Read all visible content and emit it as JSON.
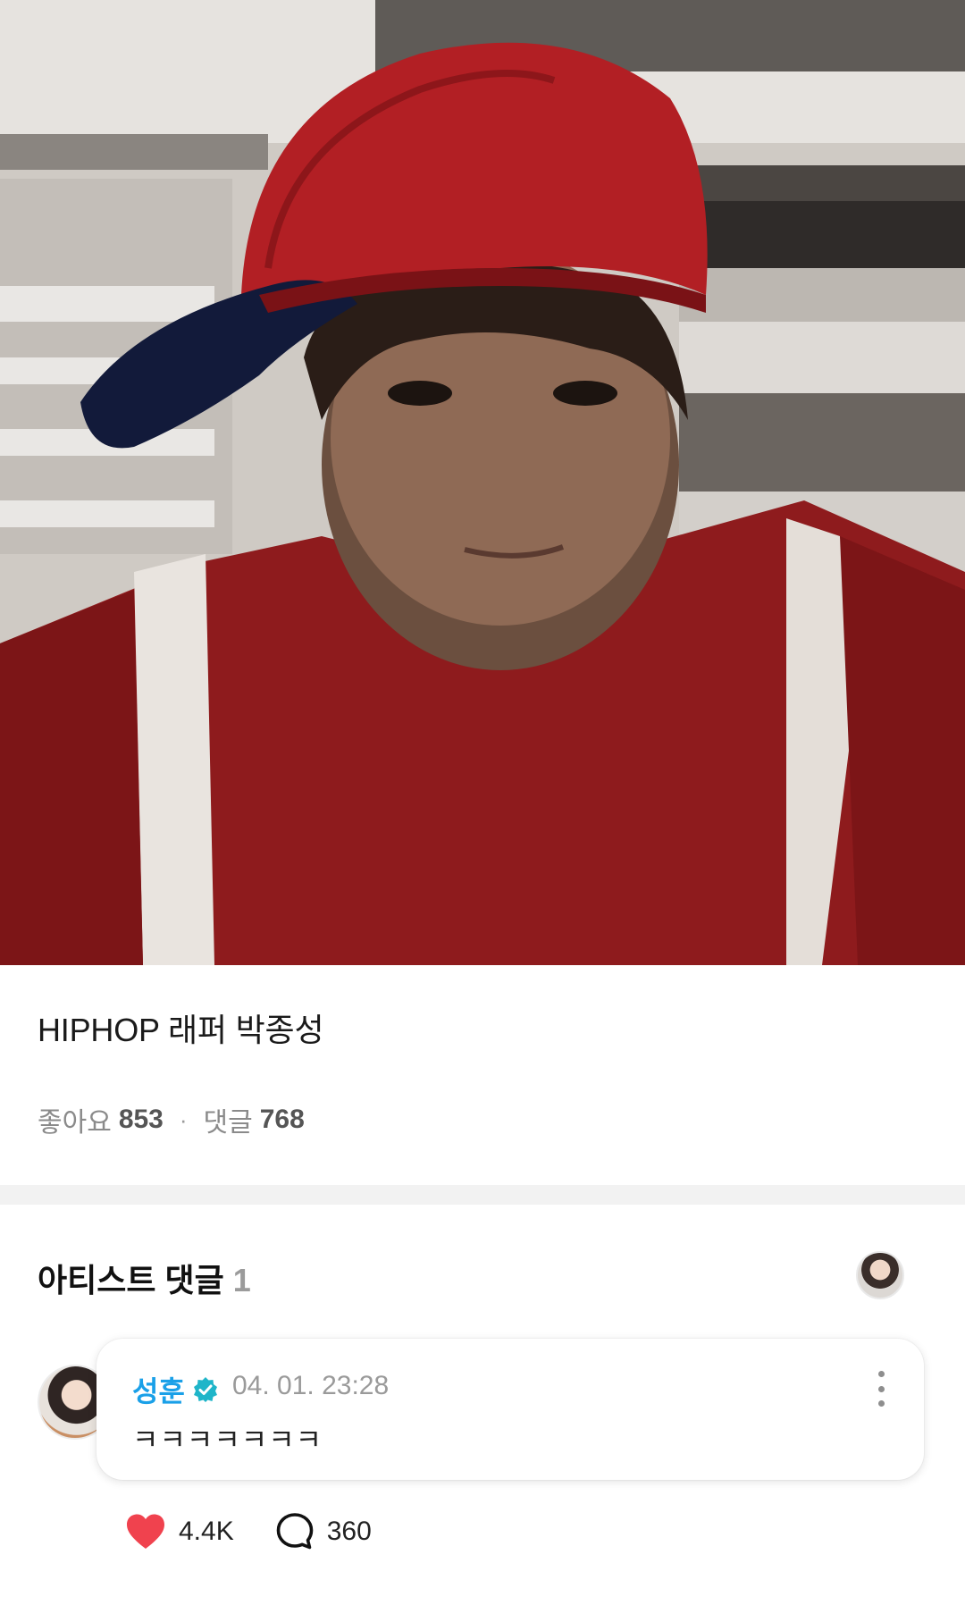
{
  "post": {
    "caption": "HIPHOP 래퍼 박종성",
    "likes_label": "좋아요",
    "likes_count": "853",
    "separator": "·",
    "comments_label": "댓글",
    "comments_count": "768"
  },
  "artist_comments": {
    "title": "아티스트 댓글",
    "count": "1",
    "items": [
      {
        "author": "성훈",
        "verified": true,
        "timestamp": "04. 01. 23:28",
        "text": "ㅋㅋㅋㅋㅋㅋㅋ",
        "like_count": "4.4K",
        "reply_count": "360"
      }
    ]
  },
  "colors": {
    "author": "#1aa0e8",
    "verified_badge": "#1fb5c9",
    "like_heart": "#f0424e",
    "divider": "#f2f2f2"
  },
  "icons": {
    "verified": "verified-badge-icon",
    "like": "heart-icon",
    "reply": "comment-bubble-icon",
    "more": "more-vertical-icon"
  }
}
